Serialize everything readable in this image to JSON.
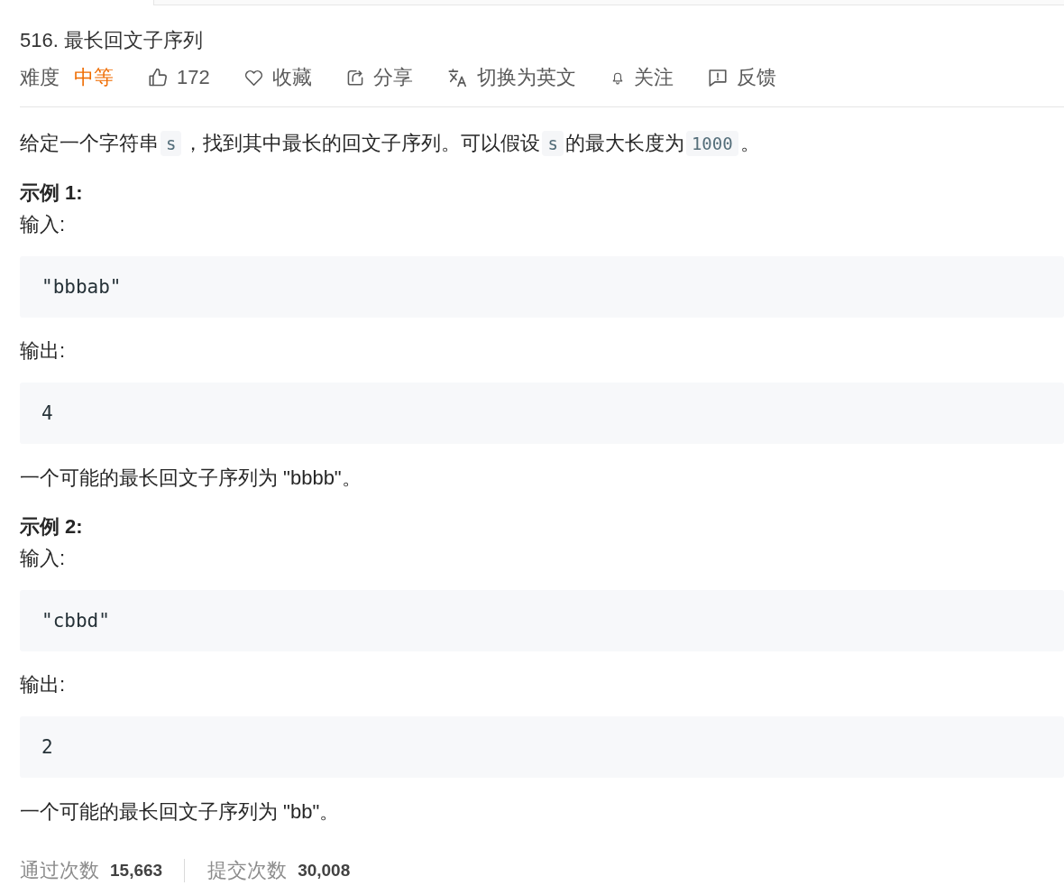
{
  "problem": {
    "title": "516. 最长回文子序列",
    "meta": {
      "difficulty_label": "难度",
      "difficulty": "中等",
      "actions": [
        {
          "kind": "like",
          "label": "172"
        },
        {
          "kind": "favorite",
          "label": "收藏"
        },
        {
          "kind": "share",
          "label": "分享"
        },
        {
          "kind": "translate",
          "label": "切换为英文"
        },
        {
          "kind": "follow",
          "label": "关注"
        },
        {
          "kind": "feedback",
          "label": "反馈"
        }
      ]
    },
    "description": [
      {
        "kind": "text",
        "text": "给定一个字符串"
      },
      {
        "kind": "code",
        "text": "s"
      },
      {
        "kind": "text",
        "text": "，找到其中最长的回文子序列。可以假设"
      },
      {
        "kind": "code",
        "text": "s"
      },
      {
        "kind": "text",
        "text": "的最大长度为"
      },
      {
        "kind": "code",
        "text": "1000"
      },
      {
        "kind": "text",
        "text": "。"
      }
    ],
    "examples": [
      {
        "heading": "示例 1:",
        "input_label": "输入:",
        "input": "\"bbbab\"",
        "output_label": "输出:",
        "output": "4",
        "explanation": "一个可能的最长回文子序列为 \"bbbb\"。"
      },
      {
        "heading": "示例 2:",
        "input_label": "输入:",
        "input": "\"cbbd\"",
        "output_label": "输出:",
        "output": "2",
        "explanation": "一个可能的最长回文子序列为 \"bb\"。"
      }
    ],
    "stats": [
      {
        "label": "通过次数",
        "value": "15,663"
      },
      {
        "label": "提交次数",
        "value": "30,008"
      }
    ]
  }
}
